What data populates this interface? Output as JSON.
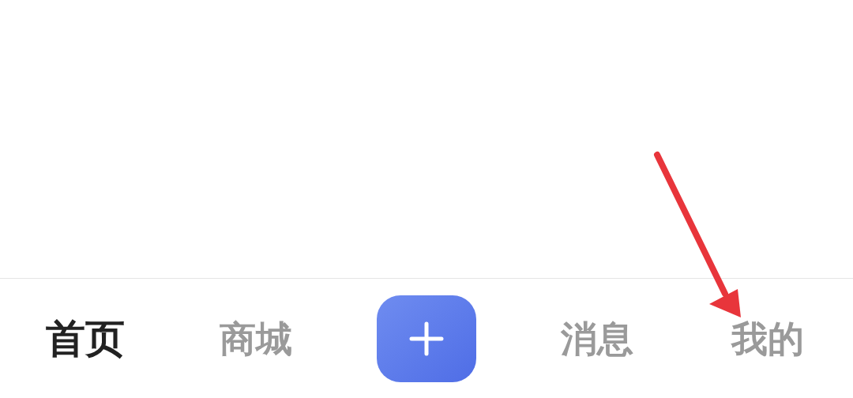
{
  "bottom_nav": [
    {
      "kind": "tab",
      "label": "首页",
      "selected": true
    },
    {
      "kind": "tab",
      "label": "商城",
      "selected": false
    },
    {
      "kind": "add"
    },
    {
      "kind": "tab",
      "label": "消息",
      "selected": false
    },
    {
      "kind": "tab",
      "label": "我的",
      "selected": false
    }
  ]
}
